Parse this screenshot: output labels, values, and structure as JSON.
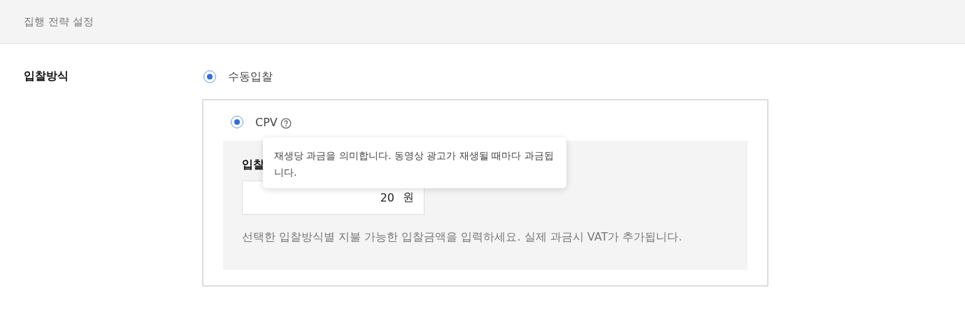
{
  "header": {
    "title": "집행 전략 설정"
  },
  "bid_method": {
    "label": "입찰방식",
    "options": [
      {
        "label": "수동입찰",
        "selected": true
      }
    ],
    "sub_options": [
      {
        "label": "CPV",
        "selected": true
      }
    ],
    "amount": {
      "label": "입찰",
      "value": "20",
      "unit": "원"
    },
    "help": "선택한 입찰방식별 지불 가능한 입찰금액을 입력하세요. 실제 과금시 VAT가 추가됩니다."
  },
  "tooltip": {
    "text": "재생당 과금을 의미합니다. 동영상 광고가 재생될 때마다 과금됩니다."
  }
}
